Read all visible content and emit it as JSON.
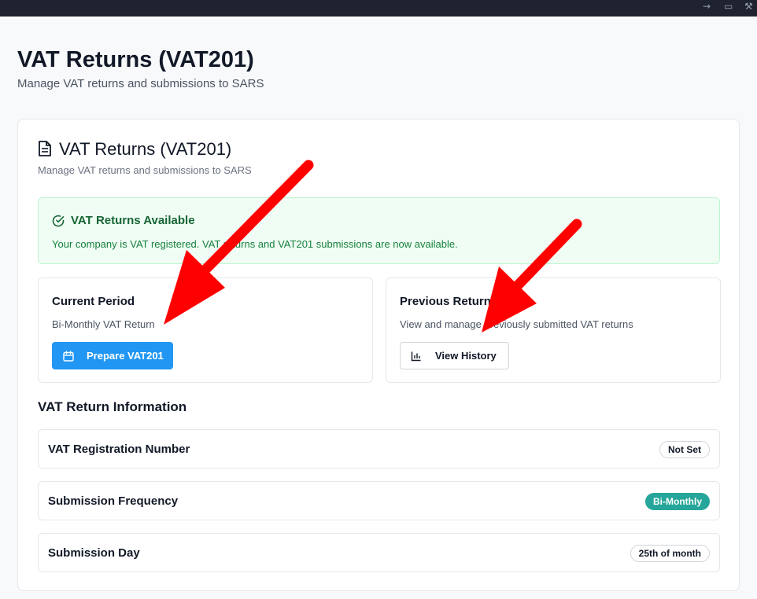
{
  "page": {
    "title": "VAT Returns (VAT201)",
    "subtitle": "Manage VAT returns and submissions to SARS"
  },
  "card": {
    "icon": "document-icon",
    "title": "VAT Returns (VAT201)",
    "subtitle": "Manage VAT returns and submissions to SARS"
  },
  "alert": {
    "icon": "check-circle-icon",
    "title": "VAT Returns Available",
    "text": "Your company is VAT registered. VAT returns and VAT201 submissions are now available."
  },
  "current_period": {
    "title": "Current Period",
    "subtitle": "Bi-Monthly VAT Return",
    "button_icon": "calendar-icon",
    "button_label": "Prepare VAT201"
  },
  "previous_returns": {
    "title": "Previous Returns",
    "subtitle": "View and manage previously submitted VAT returns",
    "button_icon": "bar-chart-icon",
    "button_label": "View History"
  },
  "info": {
    "title": "VAT Return Information",
    "rows": [
      {
        "label": "VAT Registration Number",
        "value": "Not Set"
      },
      {
        "label": "Submission Frequency",
        "value": "Bi-Monthly"
      },
      {
        "label": "Submission Day",
        "value": "25th of month"
      }
    ]
  },
  "colors": {
    "primary": "#2196f3",
    "success_bg": "#f0fdf4",
    "success_text": "#166534",
    "teal_badge": "#26a69a",
    "annotation_arrow": "#ff0000"
  },
  "annotations": {
    "arrow_icons": [
      "red-arrow-icon",
      "red-arrow-icon"
    ]
  }
}
